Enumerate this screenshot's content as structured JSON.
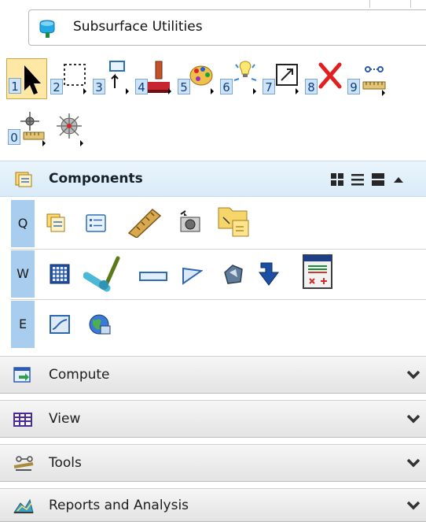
{
  "window": {
    "title": "Subsurface Utilities",
    "title_icon": "subsurface-utilities-icon"
  },
  "toolbar": {
    "items": [
      {
        "name": "select-tool",
        "number": "1",
        "icon": "arrow-pointer-icon",
        "selected": true
      },
      {
        "name": "fence-tool",
        "number": "2",
        "icon": "dashed-rectangle-icon",
        "selected": false
      },
      {
        "name": "element-info-tool",
        "number": "3",
        "icon": "info-arrow-icon",
        "selected": false
      },
      {
        "name": "paint-tool",
        "number": "4",
        "icon": "paintbrush-icon",
        "selected": false
      },
      {
        "name": "palette-tool",
        "number": "5",
        "icon": "palette-icon",
        "selected": false
      },
      {
        "name": "highlight-tool",
        "number": "6",
        "icon": "lightbulb-icon",
        "selected": false
      },
      {
        "name": "scale-tool",
        "number": "7",
        "icon": "resize-box-icon",
        "selected": false
      },
      {
        "name": "delete-tool",
        "number": "8",
        "icon": "red-x-icon",
        "selected": false
      },
      {
        "name": "measure-distance-tool",
        "number": "9",
        "icon": "measure-ruler-icon",
        "selected": false
      },
      {
        "name": "measure-point-tool",
        "number": "0",
        "icon": "measure-point-icon",
        "selected": false
      },
      {
        "name": "snap-tool",
        "number": "",
        "icon": "target-crosshair-icon",
        "selected": false
      }
    ]
  },
  "components": {
    "label": "Components",
    "view_buttons": [
      "grid-view-icon",
      "list-view-icon",
      "large-view-icon",
      "collapse-up-icon"
    ],
    "rows": [
      {
        "key": "Q",
        "icons": [
          "components-icon",
          "properties-list-icon",
          "ruler-icon",
          "camera-icon",
          "folder-icon"
        ]
      },
      {
        "key": "W",
        "icons": [
          "grid-panel-icon",
          "pipe-node-icon",
          "conduit-icon",
          "flag-icon",
          "gem-icon",
          "download-arrow-icon",
          "calculator-icon"
        ]
      },
      {
        "key": "E",
        "icons": [
          "profile-icon",
          "globe-icon"
        ]
      }
    ]
  },
  "sections": [
    {
      "label": "Compute",
      "icon": "compute-icon",
      "expanded": false
    },
    {
      "label": "View",
      "icon": "table-icon",
      "expanded": false
    },
    {
      "label": "Tools",
      "icon": "tools-icon",
      "expanded": false
    },
    {
      "label": "Reports and Analysis",
      "icon": "reports-icon",
      "expanded": false
    }
  ],
  "colors": {
    "accent_blue": "#a9cdee",
    "header_blue": "#d9ebf8",
    "selected_tool": "#ffe7a6",
    "number_badge": "#cfe3f7"
  }
}
